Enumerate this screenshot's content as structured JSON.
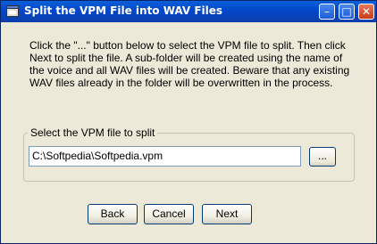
{
  "window": {
    "title": "Split the VPM File into WAV Files"
  },
  "titlebar_buttons": {
    "minimize": "–",
    "maximize": "□",
    "close": "✕"
  },
  "intro_text": "Click the \"...\" button below to select the VPM file to split. Then click Next to split the file. A sub-folder will be created using the name of the voice and all WAV files will be created. Beware that any existing WAV files already in the folder will be overwritten in the process.",
  "file_group": {
    "label": "Select the VPM file to split",
    "path_value": "C:\\Softpedia\\Softpedia.vpm",
    "browse_label": "..."
  },
  "buttons": {
    "back": "Back",
    "cancel": "Cancel",
    "next": "Next"
  },
  "colors": {
    "titlebar": "#0347c9",
    "window_bg": "#ece9d8",
    "close_button": "#c63b18"
  }
}
